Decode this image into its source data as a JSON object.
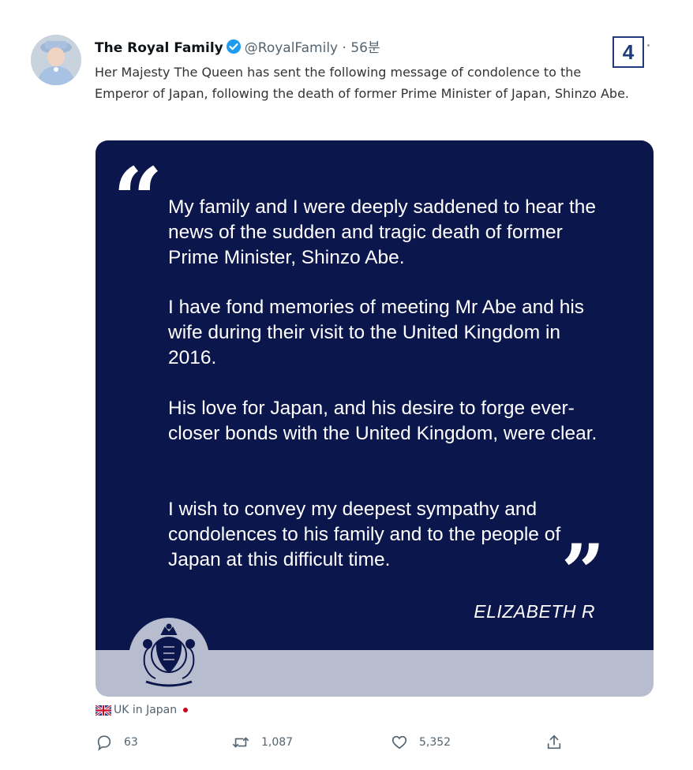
{
  "tweet": {
    "author_name": "The Royal Family",
    "handle": "@RoyalFamily",
    "separator": "·",
    "time": "56분",
    "text": "Her Majesty The Queen has sent the following message of condolence to the Emperor of Japan, following the death of former Prime Minister of Japan, Shinzo Abe."
  },
  "badge": {
    "number": "4"
  },
  "card": {
    "paragraphs": [
      "My family and I were deeply saddened to hear the news of the sudden and tragic death of former Prime Minister, Shinzo Abe.",
      "I have fond memories of meeting Mr Abe and his wife during their visit to the United Kingdom in 2016.",
      "His love for Japan, and his desire to forge ever-closer bonds with the United Kingdom, were clear.",
      "I wish to convey my deepest sympathy and condolences to his family and to the people of Japan at this difficult time."
    ],
    "open_quote": "“",
    "close_quote": "”",
    "signature": "ELIZABETH R",
    "colors": {
      "navy": "#0b164c",
      "band": "#b8bccf"
    }
  },
  "footer": {
    "tag": "UK in Japan"
  },
  "actions": {
    "replies": "63",
    "retweets": "1,087",
    "likes": "5,352"
  },
  "icons": [
    "avatar",
    "verified-icon",
    "quote-open-icon",
    "quote-close-icon",
    "royal-crest-icon",
    "uk-flag-icon",
    "japan-flag-icon",
    "reply-icon",
    "retweet-icon",
    "like-icon",
    "share-icon"
  ]
}
